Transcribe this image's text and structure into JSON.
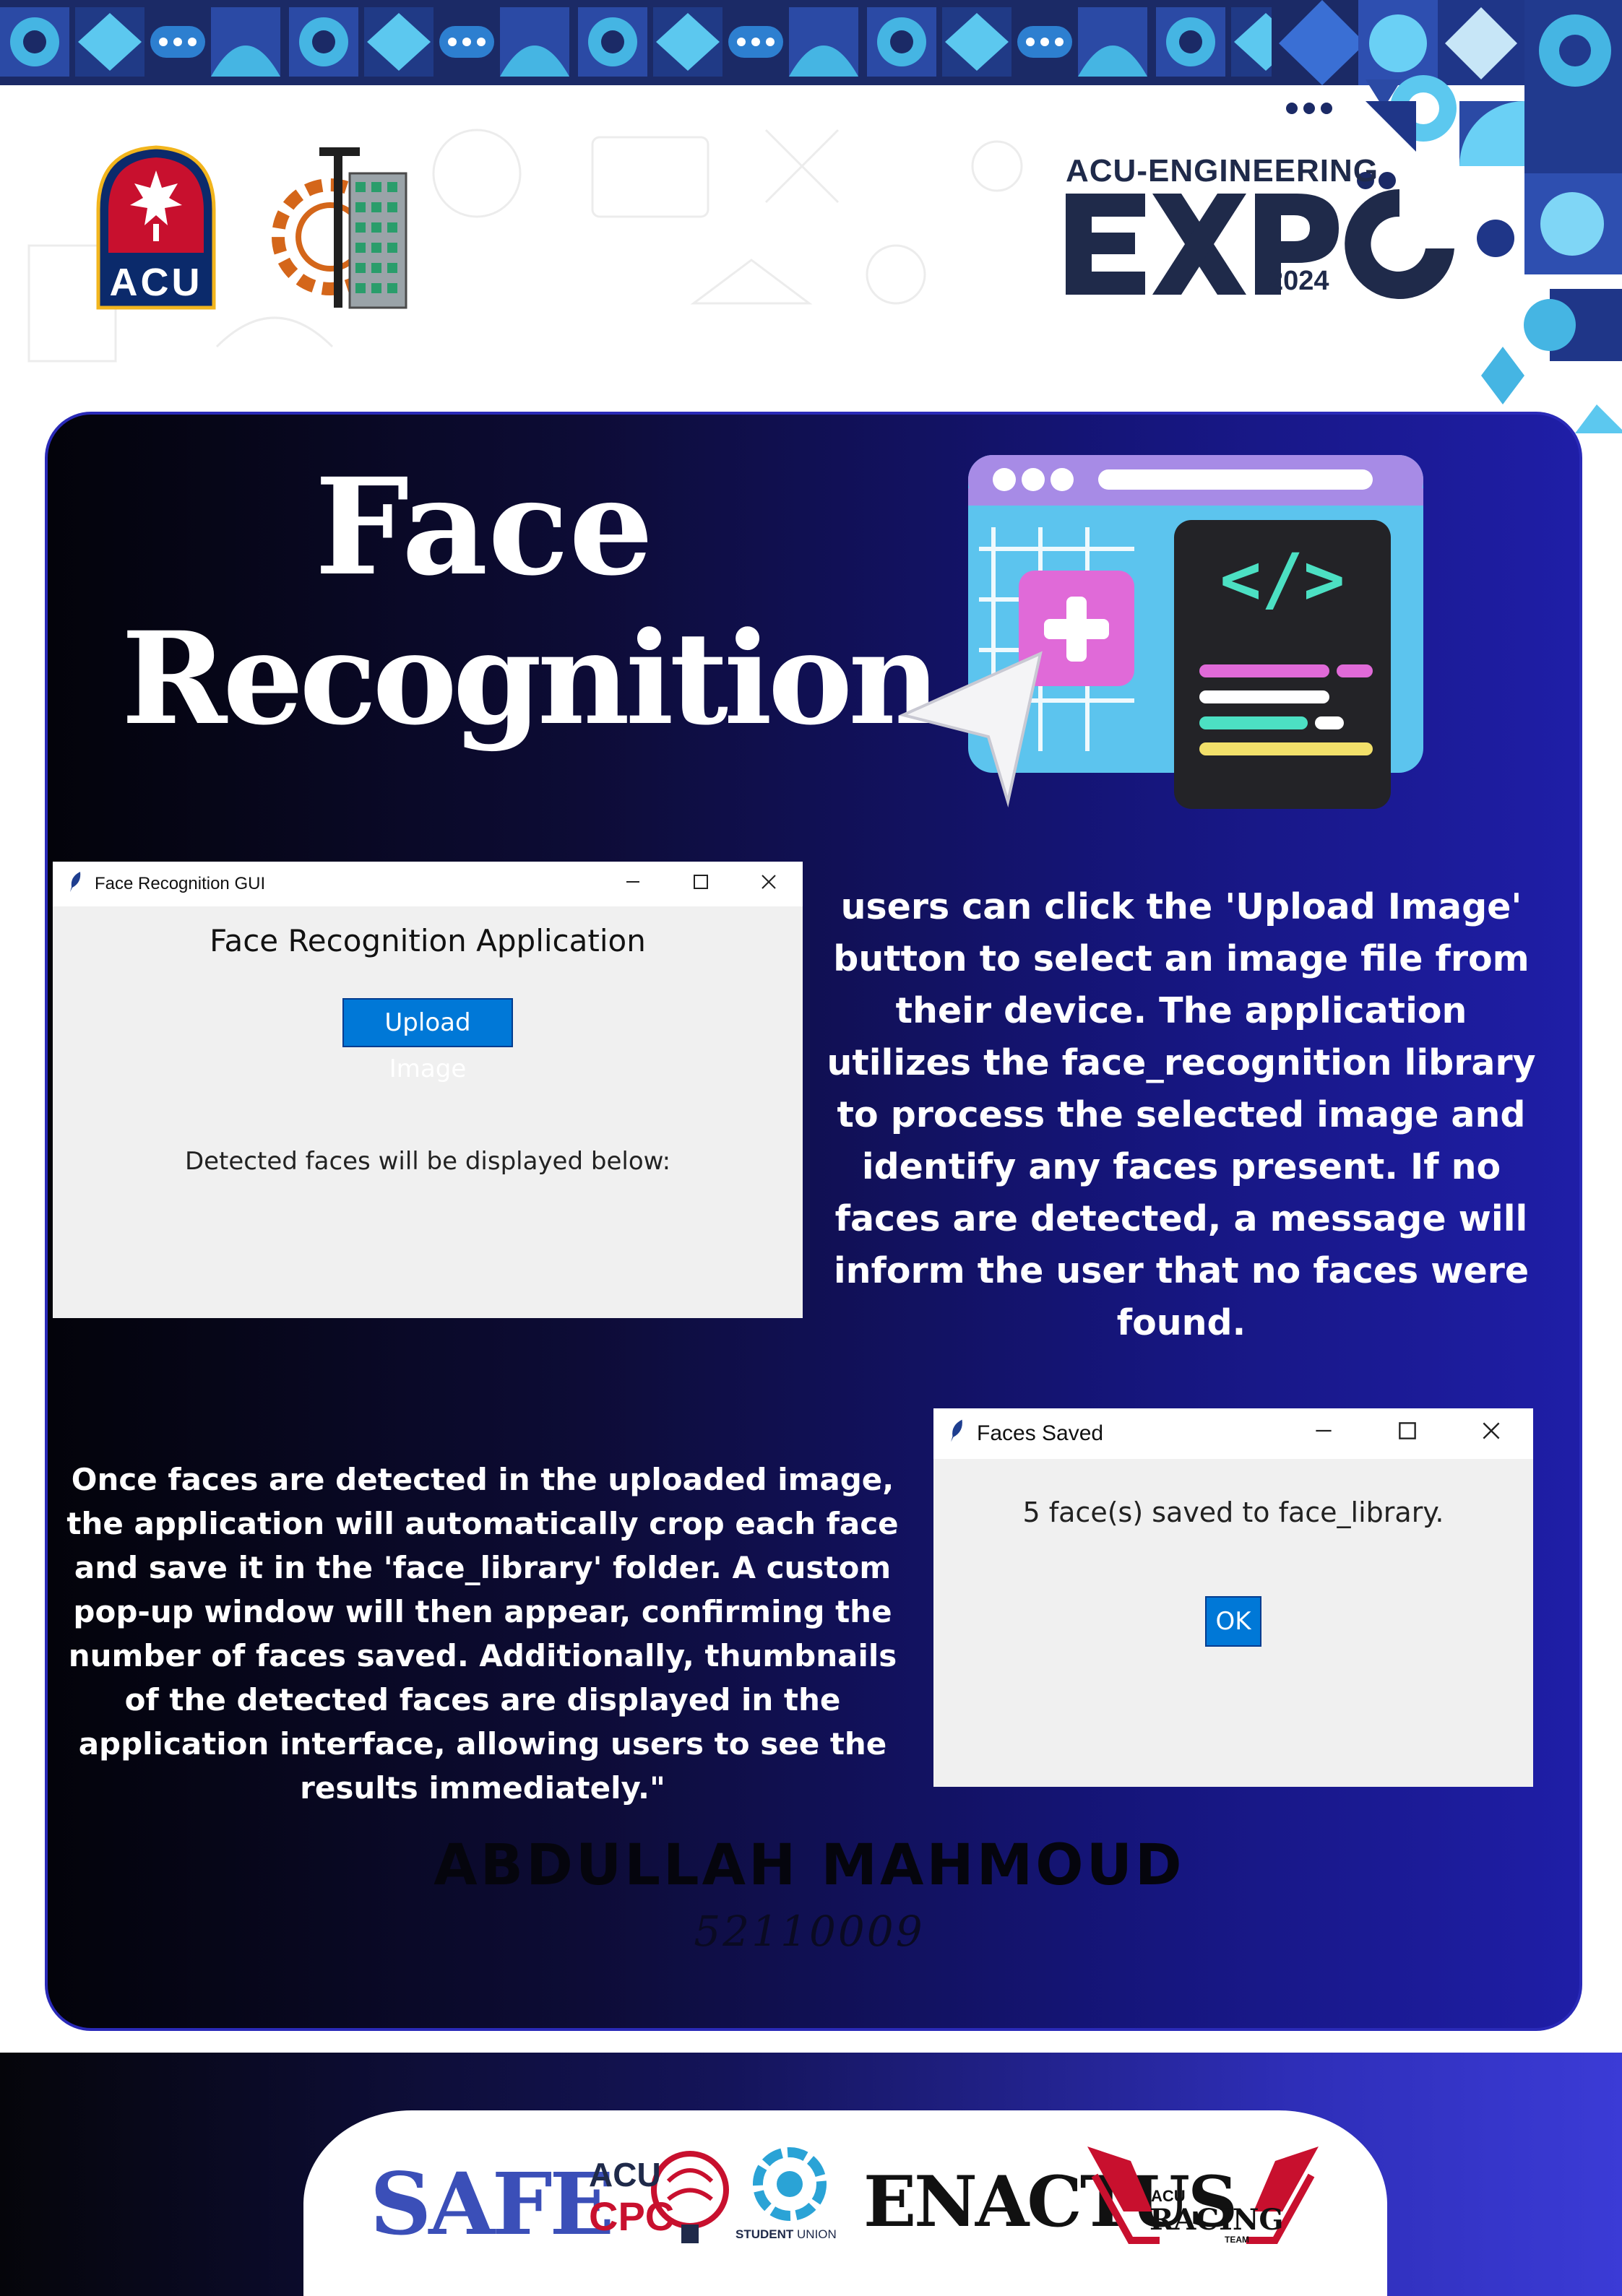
{
  "header": {
    "university_logo_text": "ACU",
    "expo_top_text": "ACU-ENGINEERING",
    "expo_word": "EXPO",
    "expo_year": "2024"
  },
  "project": {
    "title_line1": "Face",
    "title_line2": "Recognition",
    "description_upload": "users can click the 'Upload Image' button to select an image file from their device. The application utilizes the face_recognition library to process the selected image and identify any faces present. If no faces are detected, a message will inform the user that no faces were found.",
    "description_save": "Once faces are detected in the uploaded image, the application will automatically crop each face and save it in the 'face_library' folder. A custom pop-up window will then appear, confirming the number of faces saved. Additionally, thumbnails of the detected faces are displayed in the application interface, allowing users to see the results immediately.\""
  },
  "main_window": {
    "title": "Face Recognition GUI",
    "heading": "Face Recognition Application",
    "upload_button": "Upload Image",
    "note": "Detected faces will be displayed below:"
  },
  "popup_window": {
    "title": "Faces Saved",
    "message": "5 face(s) saved to face_library.",
    "ok_button": "OK"
  },
  "author": {
    "name": "ABDULLAH MAHMOUD",
    "id": "52110009"
  },
  "sponsors": {
    "safe": "SAFE",
    "acu_cpc_top": "ACU",
    "acu_cpc_bottom": "CPC",
    "student_union_a": "STUDENT",
    "student_union_b": "UNION",
    "enactus": "ENACTUS",
    "racing_top": "ACU",
    "racing_mid": "RACING",
    "racing_bottom": "TEAM"
  },
  "colors": {
    "panel_dark": "#03030a",
    "panel_blue": "#1f1ea7",
    "button_blue": "#0078d7",
    "window_bg": "#f0f0f0"
  }
}
